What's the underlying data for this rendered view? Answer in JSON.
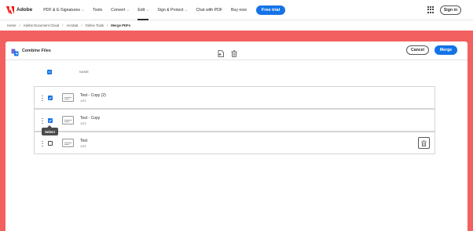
{
  "brand": {
    "name": "Adobe",
    "color": "#fa0f00"
  },
  "nav": {
    "items": [
      {
        "label": "PDF & E-Signatures",
        "dropdown": true
      },
      {
        "label": "Tools",
        "dropdown": false
      },
      {
        "label": "Convert",
        "dropdown": true
      },
      {
        "label": "Edit",
        "dropdown": true,
        "active": true
      },
      {
        "label": "Sign & Protect",
        "dropdown": true
      },
      {
        "label": "Chat with PDF",
        "dropdown": false
      },
      {
        "label": "Buy now",
        "dropdown": false
      }
    ],
    "free_trial": "Free trial",
    "sign_in": "Sign in",
    "apps_icon": "apps-grid-icon"
  },
  "breadcrumb": [
    "Home",
    "Adobe Document Cloud",
    "Acrobat",
    "Online Tools",
    "Merge PDFs"
  ],
  "panel": {
    "title": "Combine Files",
    "cancel": "Cancel",
    "merge": "Merge",
    "accent": "#1473e6",
    "background": "#f26060"
  },
  "list": {
    "column_name": "NAME",
    "files": [
      {
        "name": "Test - Copy (2)",
        "pages": "1/23",
        "checked": true
      },
      {
        "name": "Test - Copy",
        "pages": "1/23",
        "checked": true
      },
      {
        "name": "Test",
        "pages": "1/23",
        "checked": false
      }
    ],
    "tooltip": "Select"
  }
}
